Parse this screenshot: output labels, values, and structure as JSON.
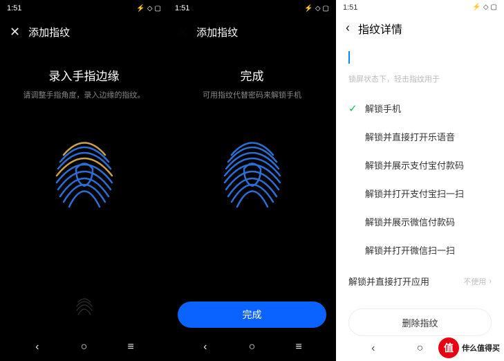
{
  "status": {
    "time": "1:51"
  },
  "screens": {
    "enroll": {
      "header_title": "添加指纹",
      "heading": "录入手指边缘",
      "subheading": "请调整手指角度，录入边缘的指纹。"
    },
    "done": {
      "header_title": "添加指纹",
      "heading": "完成",
      "subheading": "可用指纹代替密码来解锁手机",
      "button": "完成"
    },
    "detail": {
      "header_title": "指纹详情",
      "hint": "锁屏状态下，轻击指纹用于",
      "options": [
        "解锁手机",
        "解锁并直接打开乐语音",
        "解锁并展示支付宝付款码",
        "解锁并打开支付宝扫一扫",
        "解锁并展示微信付款码",
        "解锁并打开微信扫一扫"
      ],
      "app_row_label": "解锁并直接打开应用",
      "app_row_value": "不使用",
      "delete": "删除指纹"
    }
  },
  "watermark": {
    "badge": "值",
    "text": "什么值得买"
  },
  "colors": {
    "accent": "#0a62ff",
    "check": "#00c853",
    "fp_blue": "#2a6fd6",
    "fp_gold": "#c9a34a"
  }
}
